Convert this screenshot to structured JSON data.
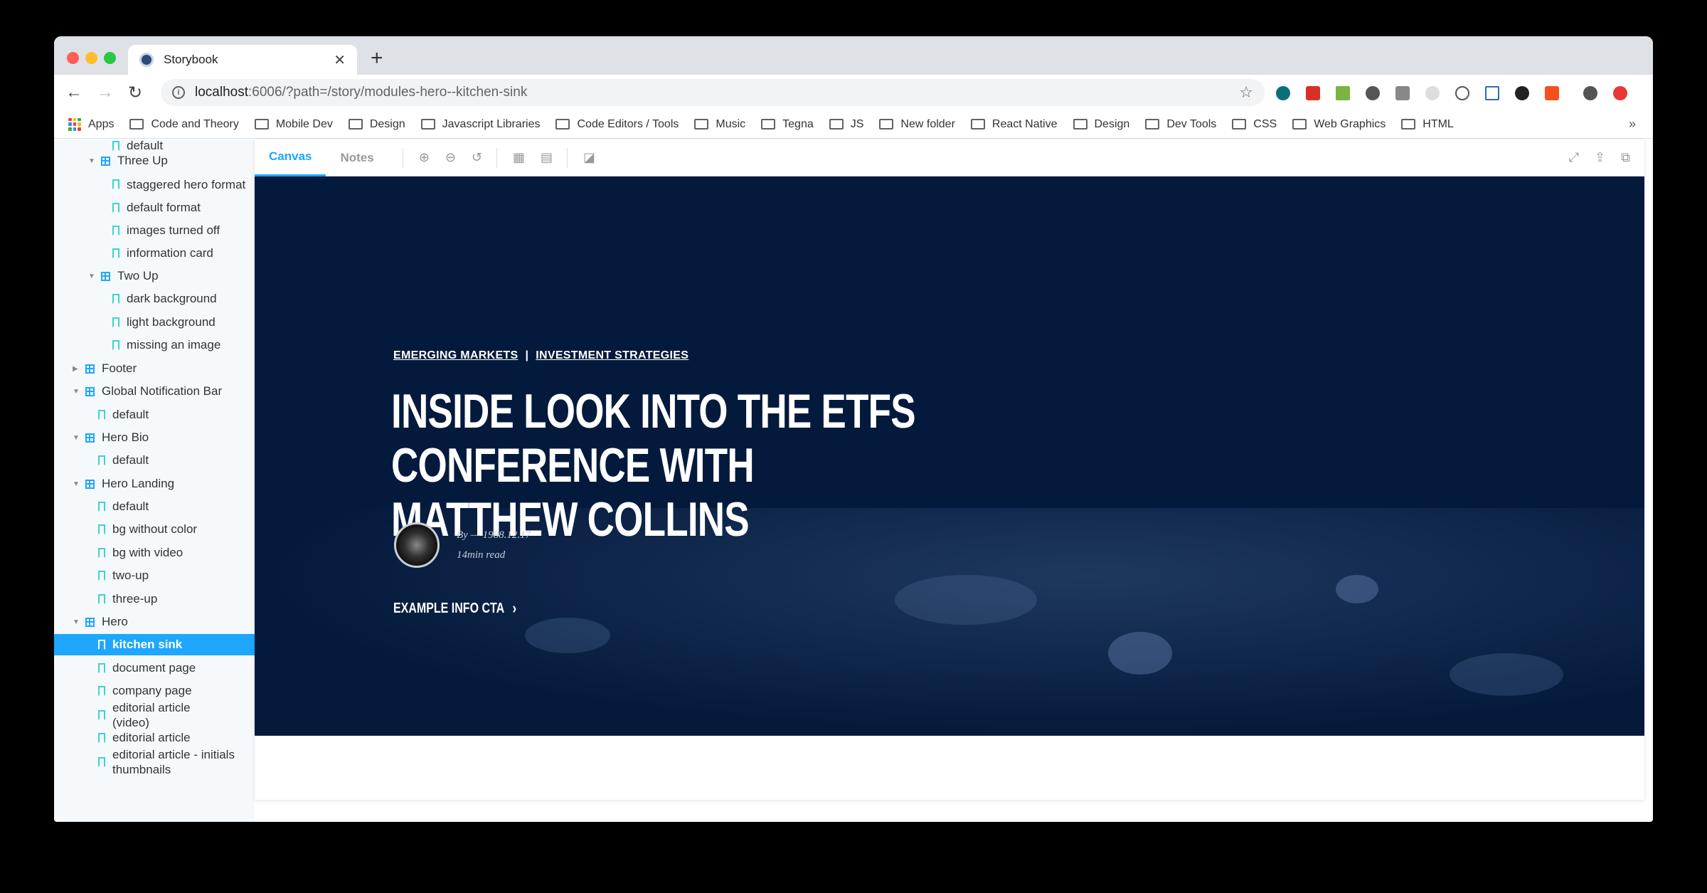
{
  "browser": {
    "tab_title": "Storybook",
    "tab_close": "✕",
    "new_tab": "+",
    "url_host": "localhost",
    "url_rest": ":6006/?path=/story/modules-hero--kitchen-sink",
    "back": "←",
    "forward": "→",
    "reload": "↻",
    "star": "☆",
    "info": "i"
  },
  "bookmarks": {
    "apps_label": "Apps",
    "items": [
      "Code and Theory",
      "Mobile Dev",
      "Design",
      "Javascript Libraries",
      "Code Editors / Tools",
      "Music",
      "Tegna",
      "JS",
      "New folder",
      "React Native",
      "Design",
      "Dev Tools",
      "CSS",
      "Web Graphics",
      "HTML"
    ],
    "more": "»"
  },
  "sidebar": {
    "nodes": [
      {
        "label": "default",
        "type": "story"
      },
      {
        "label": "Three Up",
        "type": "component"
      },
      {
        "label": "staggered hero format",
        "type": "story"
      },
      {
        "label": "default format",
        "type": "story"
      },
      {
        "label": "images turned off",
        "type": "story"
      },
      {
        "label": "information card",
        "type": "story"
      },
      {
        "label": "Two Up",
        "type": "component"
      },
      {
        "label": "dark background",
        "type": "story"
      },
      {
        "label": "light background",
        "type": "story"
      },
      {
        "label": "missing an image",
        "type": "story"
      },
      {
        "label": "Footer",
        "type": "component"
      },
      {
        "label": "Global Notification Bar",
        "type": "component"
      },
      {
        "label": "default",
        "type": "story"
      },
      {
        "label": "Hero Bio",
        "type": "component"
      },
      {
        "label": "default",
        "type": "story"
      },
      {
        "label": "Hero Landing",
        "type": "component"
      },
      {
        "label": "default",
        "type": "story"
      },
      {
        "label": "bg without color",
        "type": "story"
      },
      {
        "label": "bg with video",
        "type": "story"
      },
      {
        "label": "two-up",
        "type": "story"
      },
      {
        "label": "three-up",
        "type": "story"
      },
      {
        "label": "Hero",
        "type": "component"
      },
      {
        "label": "kitchen sink",
        "type": "story"
      },
      {
        "label": "document page",
        "type": "story"
      },
      {
        "label": "company page",
        "type": "story"
      },
      {
        "label": "editorial article (video)",
        "type": "story"
      },
      {
        "label": "editorial article",
        "type": "story"
      },
      {
        "label": "editorial article - initials thumbnails",
        "type": "story"
      }
    ]
  },
  "panel": {
    "tabs": [
      "Canvas",
      "Notes"
    ]
  },
  "hero": {
    "eyebrow_1": "Emerging Markets",
    "eyebrow_sep": "|",
    "eyebrow_2": "Investment Strategies",
    "headline_line1": "INSIDE LOOK INTO THE ETFS CONFERENCE WITH",
    "headline_line2": "MATTHEW COLLINS",
    "byline": "By — 1988.12.17",
    "read_time": "14min read",
    "cta_label": "Example Info CTA",
    "cta_chevron": "›"
  },
  "colors": {
    "accent": "#1ea7fd",
    "hero_bg": "#041a3c"
  }
}
